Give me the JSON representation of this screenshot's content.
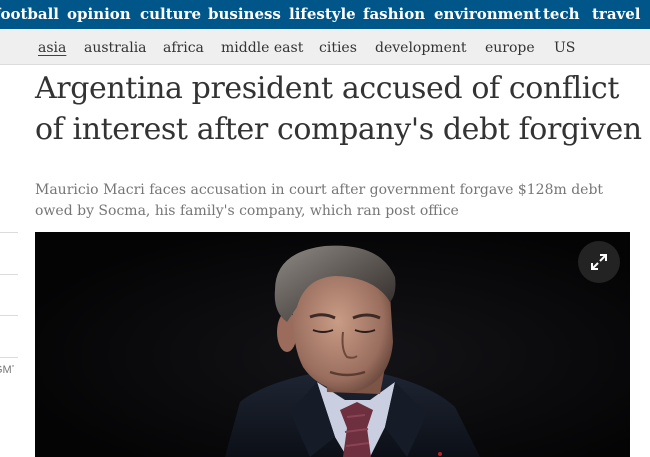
{
  "top_nav": {
    "items": [
      "football",
      "opinion",
      "culture",
      "business",
      "lifestyle",
      "fashion",
      "environment",
      "tech",
      "travel"
    ]
  },
  "sub_nav": {
    "items": [
      "asia",
      "australia",
      "africa",
      "middle east",
      "cities",
      "development",
      "europe",
      "US"
    ],
    "active": "asia"
  },
  "sidebar_fragment": "GMT",
  "article": {
    "headline": "Argentina president accused of conflict of interest after company's debt forgiven",
    "standfirst": "Mauricio Macri faces accusation in court after government forgave $128m debt owed by Socma, his family's company, which ran post office"
  },
  "media": {
    "expand_icon": "expand-arrows-icon",
    "photo_subject": "man-in-suit-photo"
  },
  "colors": {
    "nav_background": "#005689",
    "subnav_background": "#efefef",
    "headline": "#333333",
    "standfirst": "#767676"
  }
}
